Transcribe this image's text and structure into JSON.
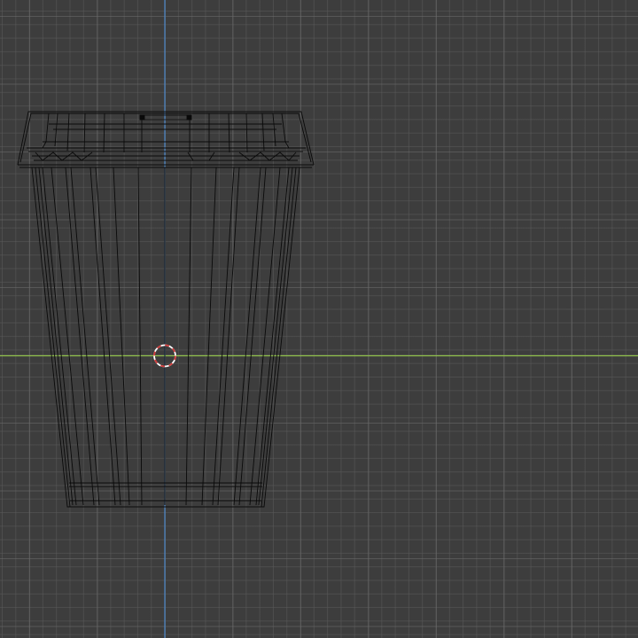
{
  "viewport": {
    "kind": "3d-viewport-wireframe",
    "axis_colors": {
      "x_axis": "#8fc04a",
      "y_axis": "#4a86c8",
      "wire": "#0a0a0a",
      "cursor_red": "#d23a3a",
      "cursor_white": "#ffffff"
    }
  },
  "object": {
    "label": "",
    "shape": "cup-with-lid"
  },
  "cursor": {
    "icon": "3d-cursor-icon"
  }
}
